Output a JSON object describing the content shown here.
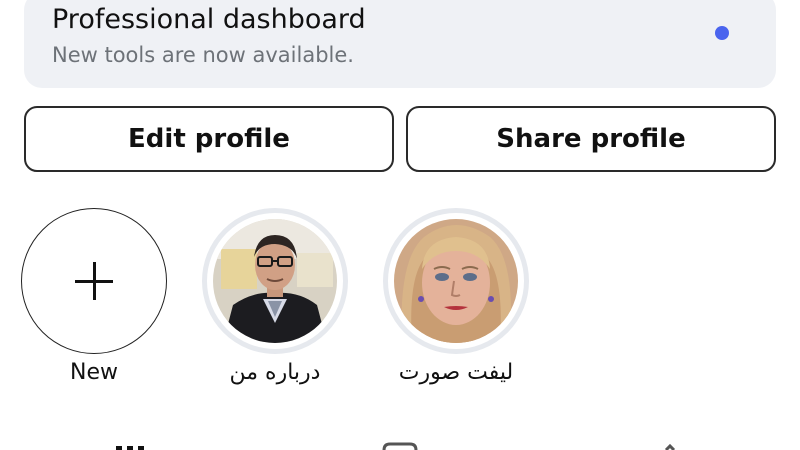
{
  "dashboard": {
    "title": "Professional dashboard",
    "subtitle": "New tools are now available.",
    "dot_color": "#4a64ee"
  },
  "actions": {
    "edit_label": "Edit profile",
    "share_label": "Share profile"
  },
  "highlights": [
    {
      "label": "New",
      "icon": "plus-icon"
    },
    {
      "label": "درباره من",
      "icon": "man-portrait"
    },
    {
      "label": "لیفت صورت",
      "icon": "woman-portrait"
    }
  ],
  "bottom_nav": {
    "icons": [
      "grid-icon",
      "reels-icon",
      "tagged-icon"
    ]
  }
}
